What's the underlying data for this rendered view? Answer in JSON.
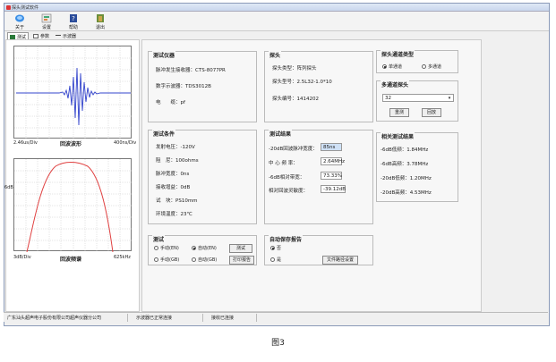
{
  "window": {
    "title": "探头测试软件"
  },
  "toolbar": {
    "items": [
      {
        "label": "关于",
        "icon": "about-icon"
      },
      {
        "label": "设置",
        "icon": "settings-icon"
      },
      {
        "label": "帮助",
        "icon": "help-icon"
      },
      {
        "label": "退出",
        "icon": "exit-icon"
      }
    ]
  },
  "tabs": [
    {
      "label": "测试",
      "icon": "test-icon"
    },
    {
      "label": "参数",
      "icon": "parameter-icon"
    },
    {
      "label": "示波器",
      "icon": "oscilloscope-icon"
    }
  ],
  "left": {
    "wave": {
      "left_label": "2.46us/Div",
      "right_label": "400ns/Div",
      "title": "回波波形"
    },
    "spectrum": {
      "y_label": "6dB",
      "left_label": "3dB/Div",
      "right_label": "625kHz",
      "title": "回波频谱"
    }
  },
  "instrument": {
    "title": "测试仪器",
    "rows": [
      {
        "key": "脉冲发生接收器：",
        "value": "CTS-8077PR"
      },
      {
        "key": "数字示波器：",
        "value": "TDS3012B"
      },
      {
        "key": "电　　缆：",
        "value": "pf"
      }
    ]
  },
  "probe": {
    "title": "探头",
    "rows": [
      {
        "key": "探头类型：",
        "value": "阵列探头"
      },
      {
        "key": "探头型号：",
        "value": "2.5L32-1.0*10"
      },
      {
        "key": "探头编号：",
        "value": "1414202"
      }
    ]
  },
  "channel_type": {
    "title": "探头通道类型",
    "options": [
      "单通道",
      "多通道"
    ],
    "selected": 0
  },
  "multi_channel": {
    "title": "多通道探头",
    "select_value": "32",
    "buttons": [
      "重测",
      "回放"
    ]
  },
  "conditions": {
    "title": "测试条件",
    "rows": [
      {
        "key": "发射电压：",
        "value": "-120V"
      },
      {
        "key": "阻　尼：",
        "value": "100ohms"
      },
      {
        "key": "脉冲宽度：",
        "value": "0ns"
      },
      {
        "key": "接收增益：",
        "value": "0dB"
      },
      {
        "key": "试　块：",
        "value": "PS10mm"
      },
      {
        "key": "环境温度：",
        "value": "23℃"
      }
    ]
  },
  "results": {
    "title": "测试结果",
    "rows": [
      {
        "key": "-20dB回波脉冲宽度：",
        "value": "85ns"
      },
      {
        "key": "中 心 频 率：",
        "value": "2.64MHz"
      },
      {
        "key": "-6dB相对带宽：",
        "value": "73.33%"
      },
      {
        "key": "相对回波灵敏度：",
        "value": "-39.12dB"
      }
    ]
  },
  "related": {
    "title": "相关测试结果",
    "rows": [
      {
        "key": "-6dB低频：",
        "value": "1.84MHz"
      },
      {
        "key": "-6dB高频：",
        "value": "3.78MHz"
      },
      {
        "key": "-20dB低频：",
        "value": "1.20MHz"
      },
      {
        "key": "-20dB高频：",
        "value": "4.53MHz"
      }
    ]
  },
  "test": {
    "title": "测试",
    "row1": [
      "手动(EN)",
      "自动(EN)"
    ],
    "row2": [
      "手动(GB)",
      "自动(GB)"
    ],
    "btn1": "测试",
    "btn2": "打印报告",
    "selected": 1
  },
  "autosave": {
    "title": "自动保存报告",
    "options": [
      "否",
      "是"
    ],
    "selected": 0,
    "button": "文件路径设置"
  },
  "status": {
    "company": "广东汕头超声电子股份有限公司超声仪器分公司",
    "scope": "示波器已正常连接",
    "device": "接收已连接"
  },
  "caption": "图3"
}
